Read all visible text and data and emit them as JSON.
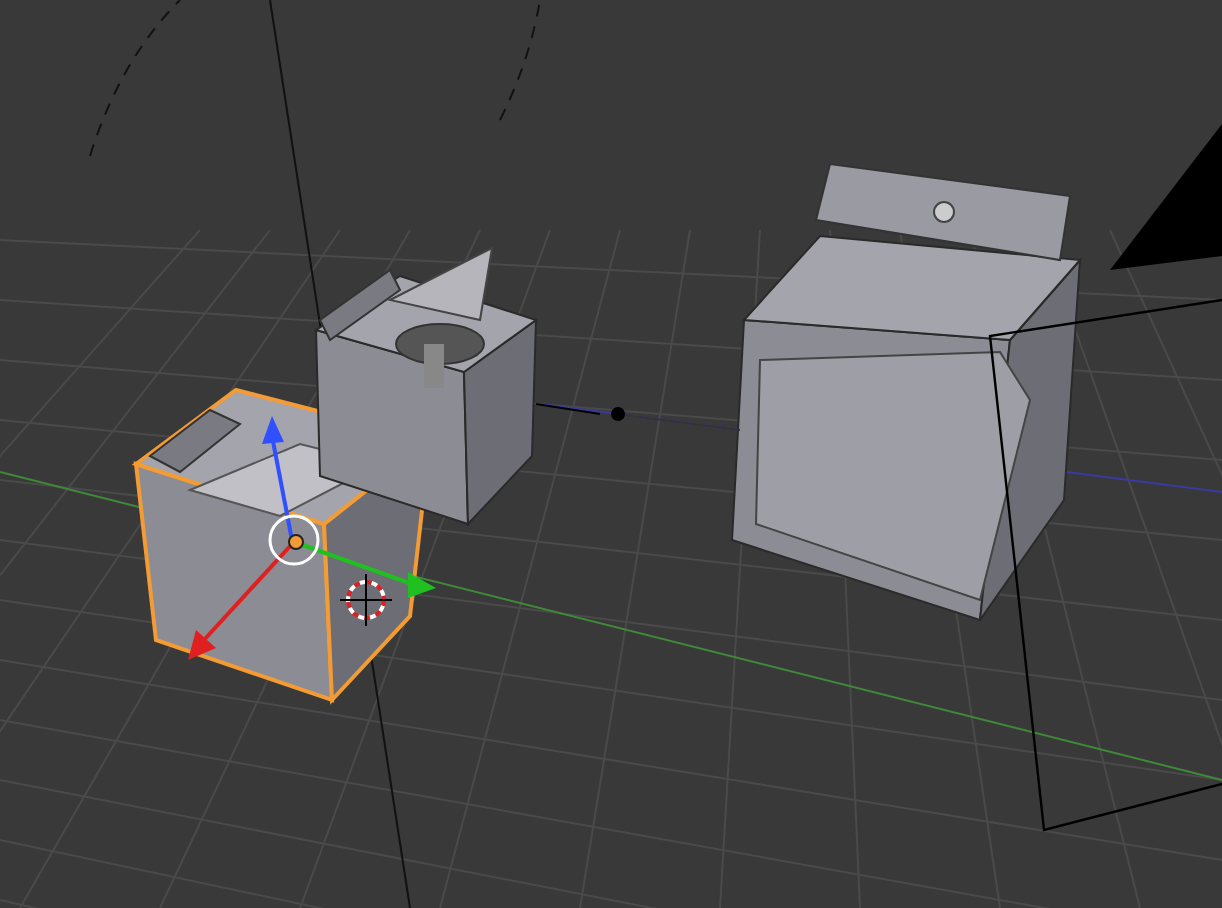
{
  "viewport": {
    "objects": [
      {
        "kind": "washer",
        "selected": true
      },
      {
        "kind": "open-washer",
        "selected": false
      },
      {
        "kind": "dryer",
        "selected": false
      },
      {
        "kind": "camera",
        "selected": false
      }
    ]
  }
}
